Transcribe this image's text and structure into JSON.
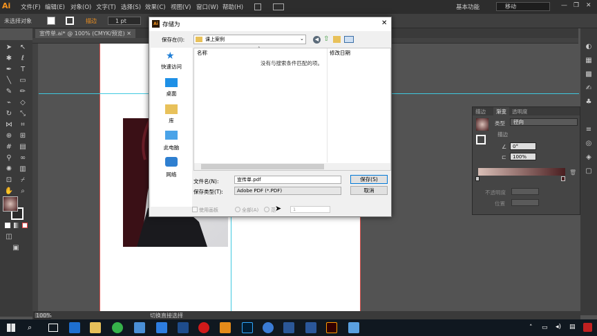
{
  "app": {
    "logo": "Ai",
    "workspace": "基本功能",
    "search_placeholder": "移动"
  },
  "menu": [
    "文件(F)",
    "编辑(E)",
    "对象(O)",
    "文字(T)",
    "选择(S)",
    "效果(C)",
    "视图(V)",
    "窗口(W)",
    "帮助(H)"
  ],
  "controlbar": {
    "selection": "未选择对象",
    "stroke_label": "描边",
    "stroke_value": "1 pt"
  },
  "tab": {
    "doc_label": "宣传单.ai* @ 100% (CMYK/预览)",
    "close": "✕"
  },
  "status": {
    "zoom": "100%",
    "tool": "切换直接选择"
  },
  "gradient_panel": {
    "tabs": [
      "描边",
      "渐变",
      "透明度"
    ],
    "type_label": "类型",
    "type_value": "径向",
    "stroke_label": "描边",
    "angle_value": "0°",
    "ratio_value": "100%",
    "opacity_label": "不透明度",
    "position_label": "位置",
    "colors": {
      "start": "#d9bfb7",
      "end": "#4a1e20"
    }
  },
  "dialog": {
    "title": "存储为",
    "save_in_label": "保存在(I):",
    "save_in_value": "课上案例",
    "sidebar": [
      "快速访问",
      "桌面",
      "库",
      "此电脑",
      "网络"
    ],
    "col_name": "名称",
    "col_date": "修改日期",
    "empty_text": "没有与搜索条件匹配的项。",
    "filename_label": "文件名(N):",
    "filename_value": "宣传单.pdf",
    "filetype_label": "保存类型(T):",
    "filetype_value": "Adobe PDF (*.PDF)",
    "save_button": "保存(S)",
    "cancel_button": "取消",
    "use_artboards": "使用画板",
    "all_label": "全部(A)",
    "range_label": "范",
    "range_value": "1"
  },
  "taskbar": {
    "time": ""
  }
}
